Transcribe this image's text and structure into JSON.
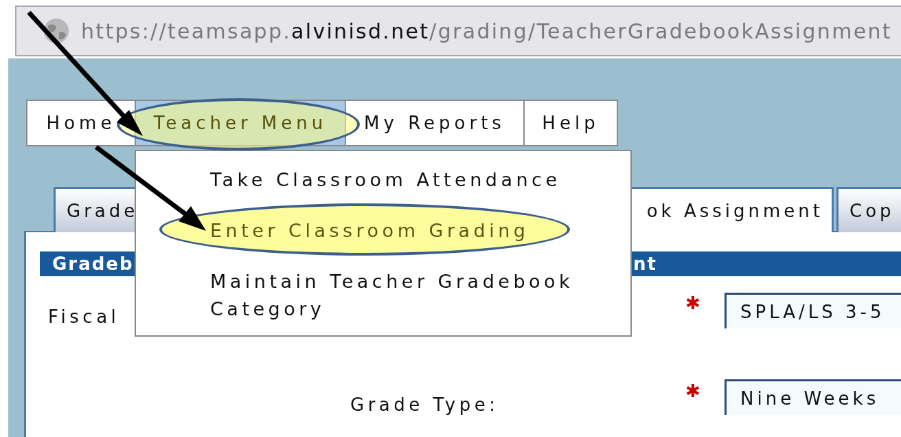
{
  "address_bar": {
    "url_prefix": "https://teamsapp.",
    "url_domain": "alvinisd.net",
    "url_path": "/grading/TeacherGradebookAssignment"
  },
  "menu": [
    {
      "label": "Home",
      "selected": false
    },
    {
      "label": "Teacher Menu",
      "selected": true
    },
    {
      "label": "My Reports",
      "selected": false
    },
    {
      "label": "Help",
      "selected": false
    }
  ],
  "dropdown": [
    {
      "label": "Take Classroom Attendance",
      "selected": false
    },
    {
      "label": "Enter Classroom Grading",
      "selected": true
    },
    {
      "label": "Maintain Teacher Gradebook Category",
      "selected": false
    }
  ],
  "tabs": [
    {
      "label": "Grade",
      "selected": false
    },
    {
      "label": "ok Assignment",
      "selected": true
    },
    {
      "label": "Cop",
      "selected": false
    }
  ],
  "section_header": {
    "left": "Gradeb",
    "right": "nt"
  },
  "fields": [
    {
      "label": "Fiscal",
      "required_mark": "✱",
      "value": "SPLA/LS 3-5"
    },
    {
      "label": "Grade Type:",
      "required_mark": "✱",
      "value": "Nine Weeks"
    }
  ]
}
